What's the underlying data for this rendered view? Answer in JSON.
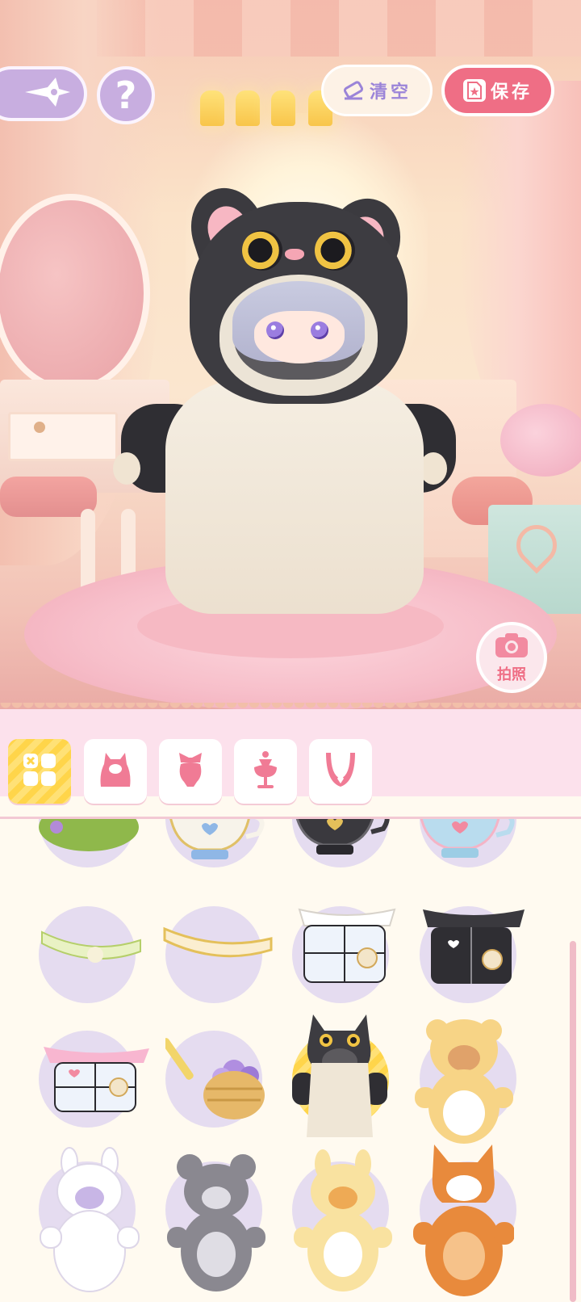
{
  "toolbar": {
    "clear_label": "清空",
    "save_label": "保存",
    "help_label": "?",
    "photo_label": "拍照"
  },
  "icons": {
    "back": "sparkle-back-icon",
    "help": "question-icon",
    "clear": "eraser-icon",
    "save": "save-file-icon",
    "photo": "camera-icon"
  },
  "colors": {
    "accent_pink": "#ef6e85",
    "accent_purple": "#c8aee0",
    "tab_active": "#ffd54a",
    "tab_icon": "#f07b95"
  },
  "category_tabs": [
    {
      "name": "all",
      "icon": "grid-icon",
      "active": true
    },
    {
      "name": "outfit",
      "icon": "hooded-outfit-icon",
      "active": false
    },
    {
      "name": "hat",
      "icon": "bow-hat-icon",
      "active": false
    },
    {
      "name": "accessory",
      "icon": "stand-accessory-icon",
      "active": false
    },
    {
      "name": "necklace",
      "icon": "necklace-icon",
      "active": false
    }
  ],
  "items": [
    {
      "name": "green-hat",
      "selected": false
    },
    {
      "name": "white-teacup",
      "selected": false
    },
    {
      "name": "black-teacup",
      "selected": false
    },
    {
      "name": "pastel-teacup",
      "selected": false
    },
    {
      "name": "green-lace-headband",
      "selected": false
    },
    {
      "name": "yellow-lace-headband",
      "selected": false
    },
    {
      "name": "white-card-dress",
      "selected": false
    },
    {
      "name": "black-card-dress",
      "selected": false
    },
    {
      "name": "pink-card-dress",
      "selected": false
    },
    {
      "name": "flower-basket",
      "selected": false
    },
    {
      "name": "black-cat-costume",
      "selected": true
    },
    {
      "name": "yellow-bear-costume",
      "selected": false
    },
    {
      "name": "white-bunny-costume",
      "selected": false
    },
    {
      "name": "gray-mouse-costume",
      "selected": false
    },
    {
      "name": "yellow-bunny-costume",
      "selected": false
    },
    {
      "name": "fox-costume",
      "selected": false
    }
  ]
}
